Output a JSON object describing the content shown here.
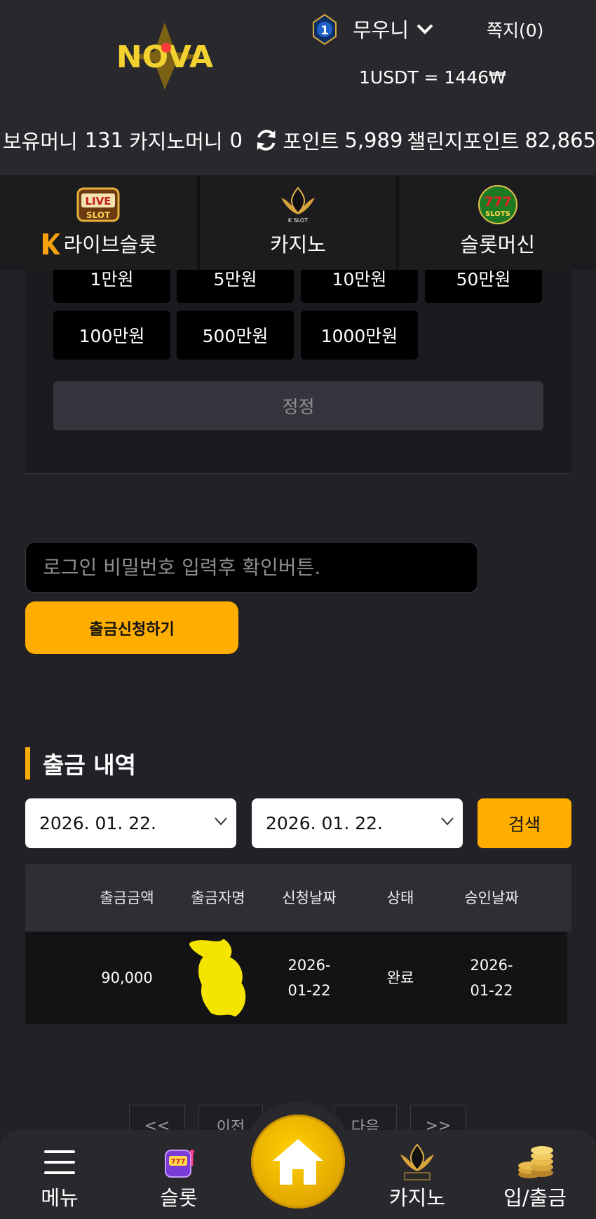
{
  "header": {
    "logo_text": "NOVA",
    "level": "1",
    "username": "무우니",
    "messages": "쪽지(0)",
    "exchange_rate": "1USDT = 1446₩"
  },
  "balances": {
    "holding_label": "보유머니",
    "holding_value": "131",
    "casino_label": "카지노머니",
    "casino_value": "0",
    "point_label": "포인트",
    "point_value": "5,989",
    "challenge_label": "챌린지포인트",
    "challenge_value": "82,865"
  },
  "tabs": [
    {
      "label": "라이브슬롯",
      "icon": "live-slot-icon",
      "badge": "LIVE",
      "badge_sub": "SLOT"
    },
    {
      "label": "카지노",
      "icon": "k-slot-icon",
      "badge": "K SLOT"
    },
    {
      "label": "슬롯머신",
      "icon": "777-slots-icon",
      "badge": "777",
      "badge_sub": "SLOTS"
    }
  ],
  "amount_buttons": [
    "1만원",
    "5만원",
    "10만원",
    "50만원",
    "100만원",
    "500만원",
    "1000만원"
  ],
  "reset_label": "정정",
  "password_placeholder": "로그인 비밀번호 입력후 확인버튼.",
  "withdraw_label": "출금신청하기",
  "history": {
    "title": "출금 내역",
    "date_from": "2026. 01. 22.",
    "date_to": "2026. 01. 22.",
    "search_label": "검색",
    "columns": [
      "출금금액",
      "출금자명",
      "신청날짜",
      "상태",
      "승인날짜"
    ],
    "rows": [
      {
        "amount": "90,000",
        "name": "",
        "request_date": "2026-01-22",
        "status": "완료",
        "approve_date": "2026-01-22"
      }
    ]
  },
  "pagination": {
    "first": "<<",
    "prev": "이전",
    "next": "다음",
    "last": ">>"
  },
  "bottom_nav": {
    "menu": "메뉴",
    "slot": "슬롯",
    "casino": "카지노",
    "deposit": "입/출금"
  },
  "colors": {
    "accent": "#ffae00",
    "background": "#222127",
    "header": "#29282d"
  }
}
